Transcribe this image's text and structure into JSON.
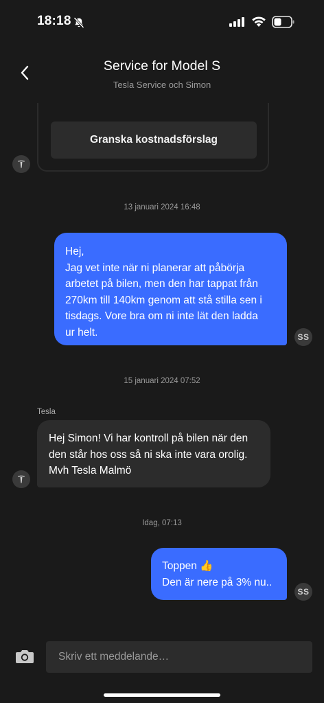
{
  "status_bar": {
    "time": "18:18"
  },
  "header": {
    "title": "Service for Model S",
    "subtitle": "Tesla Service och Simon"
  },
  "prev_card": {
    "button_label": "Granska kostnadsförslag"
  },
  "messages": [
    {
      "date": "13 januari 2024 16:48"
    },
    {
      "text": "Hej,\nJag vet inte när ni planerar att påbörja\narbetet på bilen, men den har tappat från\n270km till 140km genom att stå stilla sen i\ntisdags. Vore bra om ni inte lät den ladda\nur helt.",
      "avatar": "SS"
    },
    {
      "date": "15 januari 2024 07:52"
    },
    {
      "sender": "Tesla",
      "text": "Hej Simon! Vi har kontroll på bilen när den\nden står hos oss så ni ska inte vara orolig.\nMvh Tesla Malmö"
    },
    {
      "date": "Idag, 07:13"
    },
    {
      "text": "Toppen 👍\nDen är nere på 3% nu..",
      "avatar": "SS"
    }
  ],
  "composer": {
    "placeholder": "Skriv ett meddelande…"
  },
  "colors": {
    "background": "#1a1a1a",
    "outgoing_bubble": "#3a6cff",
    "incoming_bubble": "#2c2c2c"
  }
}
